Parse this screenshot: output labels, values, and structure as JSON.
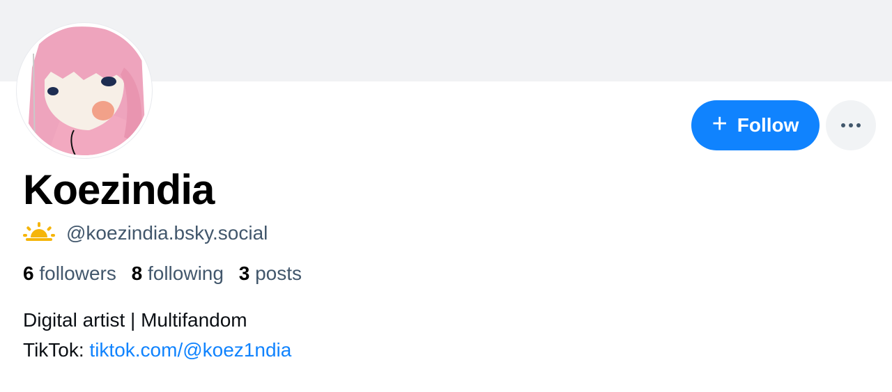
{
  "profile": {
    "display_name": "Koezindia",
    "handle": "@koezindia.bsky.social",
    "handle_icon": "sun-rising-icon",
    "stats": {
      "followers_count": "6",
      "followers_label": "followers",
      "following_count": "8",
      "following_label": "following",
      "posts_count": "3",
      "posts_label": "posts"
    },
    "bio": {
      "line1": "Digital artist | Multifandom",
      "line2_prefix": "TikTok: ",
      "link_text": "tiktok.com/@koez1ndia"
    }
  },
  "actions": {
    "follow_label": "Follow",
    "follow_icon": "plus-icon",
    "more_icon": "ellipsis-icon"
  },
  "colors": {
    "accent": "#1083fe",
    "banner": "#f1f2f4",
    "secondary_text": "#42576c",
    "sun_icon": "#f5b50a"
  }
}
